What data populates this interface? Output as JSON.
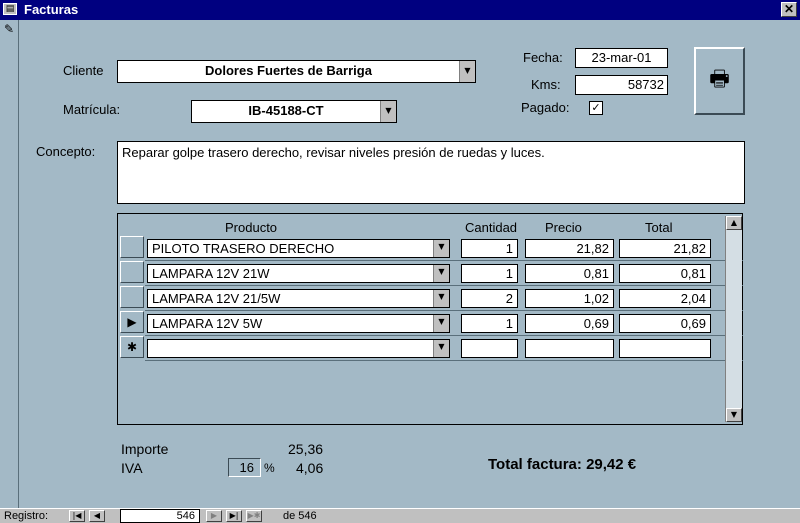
{
  "window": {
    "title": "Facturas",
    "close": "✕"
  },
  "form": {
    "cliente_label": "Cliente",
    "cliente_value": "Dolores Fuertes de Barriga",
    "matricula_label": "Matrícula:",
    "matricula_value": "IB-45188-CT",
    "fecha_label": "Fecha:",
    "fecha_value": "23-mar-01",
    "kms_label": "Kms:",
    "kms_value": "58732",
    "pagado_label": "Pagado:",
    "pagado_checked": "✓",
    "concepto_label": "Concepto:",
    "concepto_value": "Reparar golpe trasero derecho, revisar niveles presión de ruedas y luces."
  },
  "lines": {
    "headers": {
      "producto": "Producto",
      "cantidad": "Cantidad",
      "precio": "Precio",
      "total": "Total"
    },
    "current_marker": "▶",
    "new_marker": "✱",
    "rows": [
      {
        "producto": "PILOTO TRASERO DERECHO",
        "cantidad": "1",
        "precio": "21,82",
        "total": "21,82"
      },
      {
        "producto": "LAMPARA 12V 21W",
        "cantidad": "1",
        "precio": "0,81",
        "total": "0,81"
      },
      {
        "producto": "LAMPARA 12V 21/5W",
        "cantidad": "2",
        "precio": "1,02",
        "total": "2,04"
      },
      {
        "producto": "LAMPARA 12V 5W",
        "cantidad": "1",
        "precio": "0,69",
        "total": "0,69"
      }
    ]
  },
  "summary": {
    "importe_label": "Importe",
    "importe_value": "25,36",
    "iva_label": "IVA",
    "iva_pct": "16",
    "pct_sign": "%",
    "iva_value": "4,06",
    "total_label": "Total factura: 29,42 €"
  },
  "nav": {
    "registro_label": "Registro:",
    "current": "546",
    "of_label": "de 546"
  },
  "colors": {
    "background": "#a3b9c6",
    "titlebar": "#000080"
  }
}
